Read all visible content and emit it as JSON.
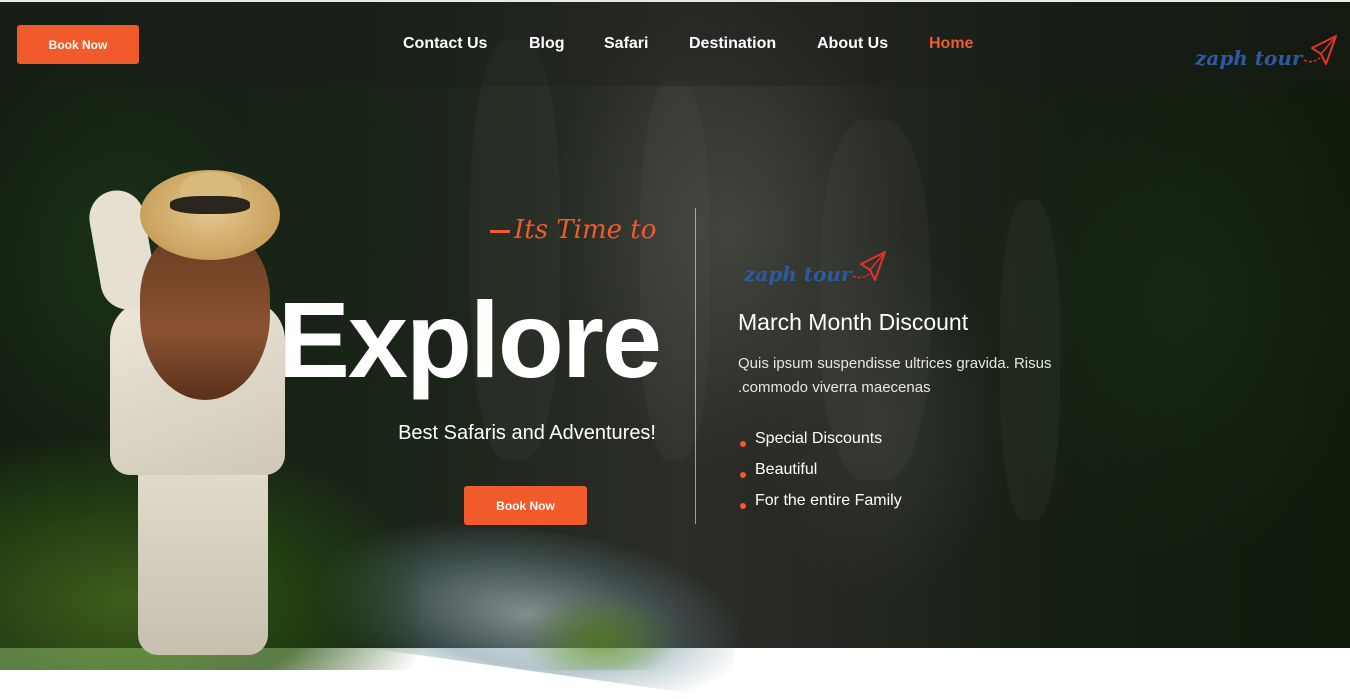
{
  "header": {
    "book_button": "Book Now",
    "nav": [
      "Contact Us",
      "Blog",
      "Safari",
      "Destination",
      "About Us",
      "Home"
    ],
    "active_nav": "Home",
    "logo": "zaph tour"
  },
  "hero": {
    "tagline": "Its Time to",
    "title": "Explore",
    "subtitle": "Best Safaris and Adventures!",
    "book_button": "Book Now"
  },
  "promo": {
    "logo": "zaph tour",
    "title": "March Month Discount",
    "description": "Quis ipsum suspendisse ultrices gravida. Risus .commodo viverra maecenas",
    "features": [
      "Special Discounts",
      "Beautiful",
      "For the entire Family"
    ]
  },
  "colors": {
    "accent": "#f15a2b",
    "logo_blue": "#2b5aa3"
  },
  "icons": {
    "logo_mark": "paper-plane-icon",
    "list_bullet": "dot-icon"
  }
}
